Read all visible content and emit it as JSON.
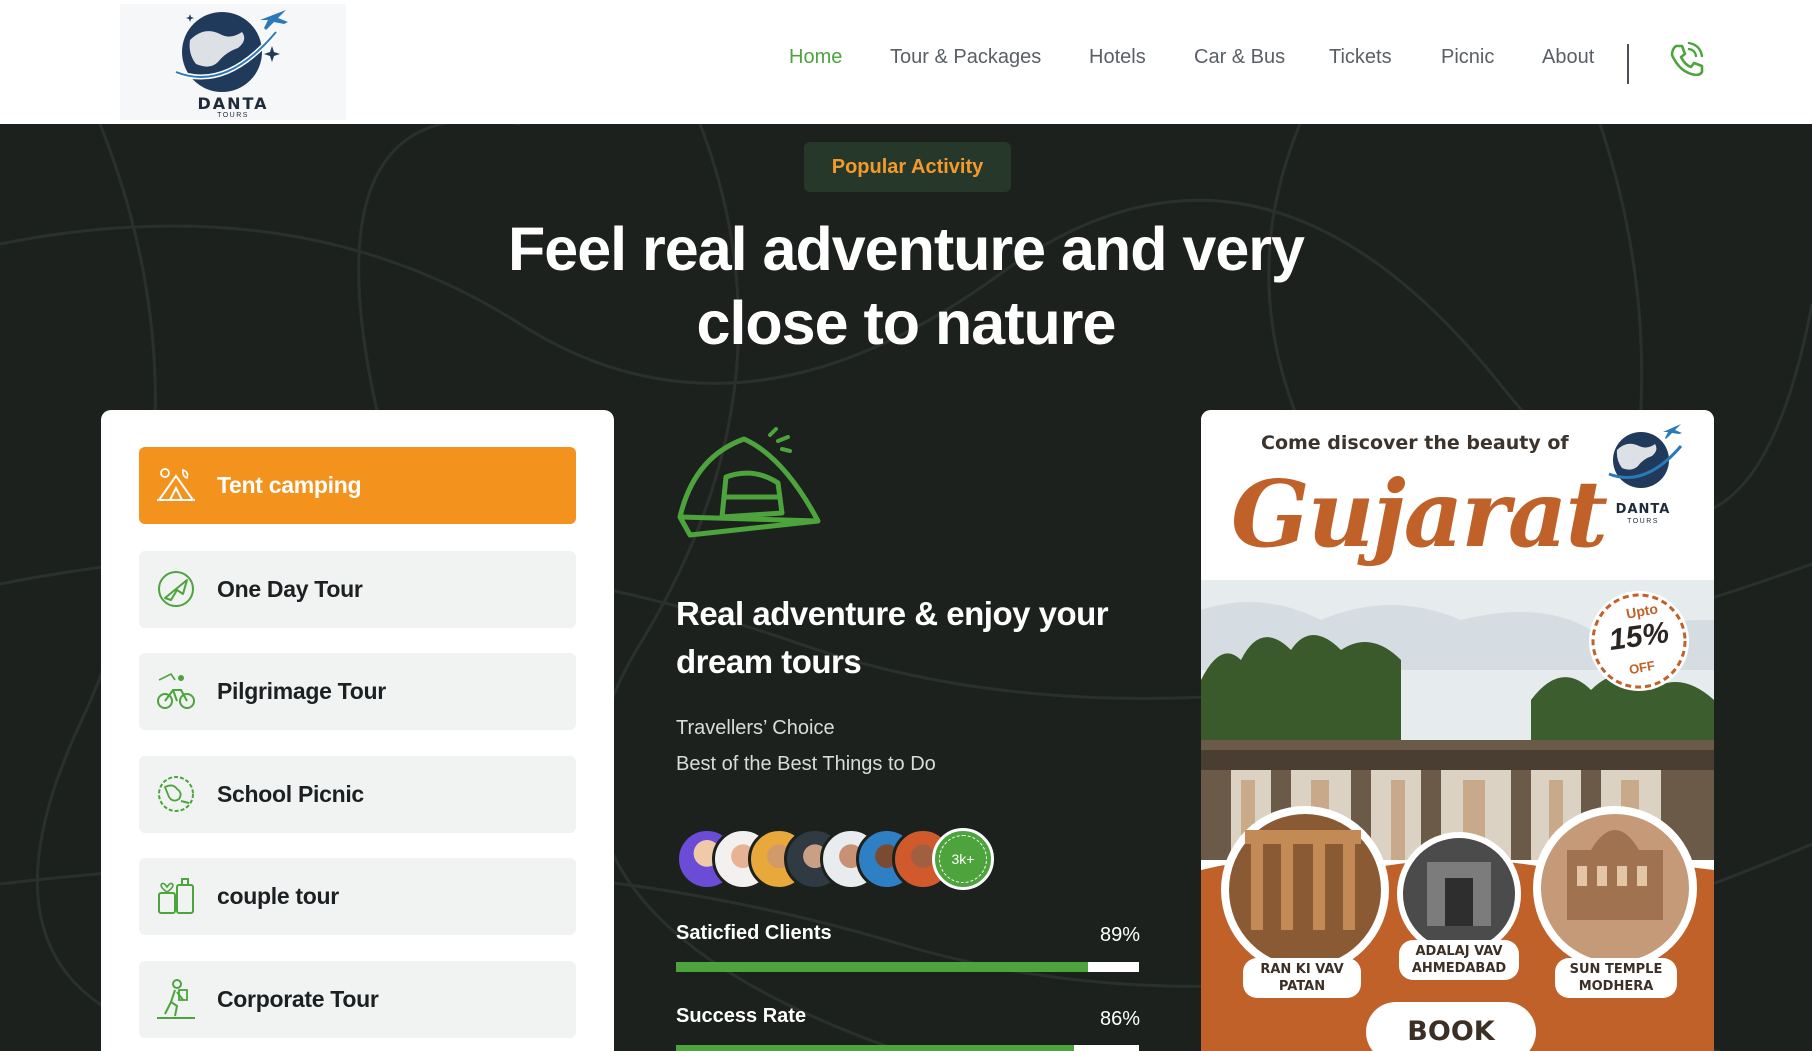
{
  "brand": {
    "name": "DANTA",
    "sub": "TOURS"
  },
  "nav": {
    "items": [
      {
        "label": "Home",
        "active": true
      },
      {
        "label": "Tour & Packages",
        "active": false
      },
      {
        "label": "Hotels",
        "active": false
      },
      {
        "label": "Car & Bus",
        "active": false
      },
      {
        "label": "Tickets",
        "active": false
      },
      {
        "label": "Picnic",
        "active": false
      },
      {
        "label": "About",
        "active": false
      }
    ],
    "phone_icon": "phone-icon"
  },
  "hero": {
    "badge": "Popular Activity",
    "headline_line1": "Feel real adventure and very",
    "headline_line2": "close to nature"
  },
  "activities": [
    {
      "label": "Tent camping",
      "icon": "tent-icon",
      "active": true
    },
    {
      "label": "One Day Tour",
      "icon": "compass-plane-icon",
      "active": false
    },
    {
      "label": "Pilgrimage Tour",
      "icon": "cyclist-icon",
      "active": false
    },
    {
      "label": "School Picnic",
      "icon": "globe-icon",
      "active": false
    },
    {
      "label": "couple tour",
      "icon": "luggage-icon",
      "active": false
    },
    {
      "label": "Corporate Tour",
      "icon": "hiker-icon",
      "active": false
    }
  ],
  "feature": {
    "icon": "tent-outline-icon",
    "title_line1": "Real adventure & enjoy your",
    "title_line2": "dream tours",
    "line1": "Travellers’ Choice",
    "line2": "Best of the Best Things to Do",
    "avatar_count": "3k+"
  },
  "stats": [
    {
      "label": "Saticfied Clients",
      "value_text": "89%",
      "value": 89
    },
    {
      "label": "Success Rate",
      "value_text": "86%",
      "value": 86
    }
  ],
  "poster": {
    "tagline": "Come discover the beauty of",
    "title": "Gujarat",
    "brand": "DANTA",
    "brand_sub": "TOURS",
    "badge_upto": "Upto",
    "badge_pct": "15%",
    "badge_off": "OFF",
    "places": [
      {
        "line1": "RAN KI VAV",
        "line2": "PATAN"
      },
      {
        "line1": "ADALAJ VAV",
        "line2": "AHMEDABAD"
      },
      {
        "line1": "SUN TEMPLE",
        "line2": "MODHERA"
      }
    ],
    "cta": "BOOK NOW"
  },
  "colors": {
    "accent_green": "#4da43d",
    "accent_orange": "#f4921e",
    "hero_bg": "#1c211d",
    "poster_brown": "#c0612a"
  }
}
